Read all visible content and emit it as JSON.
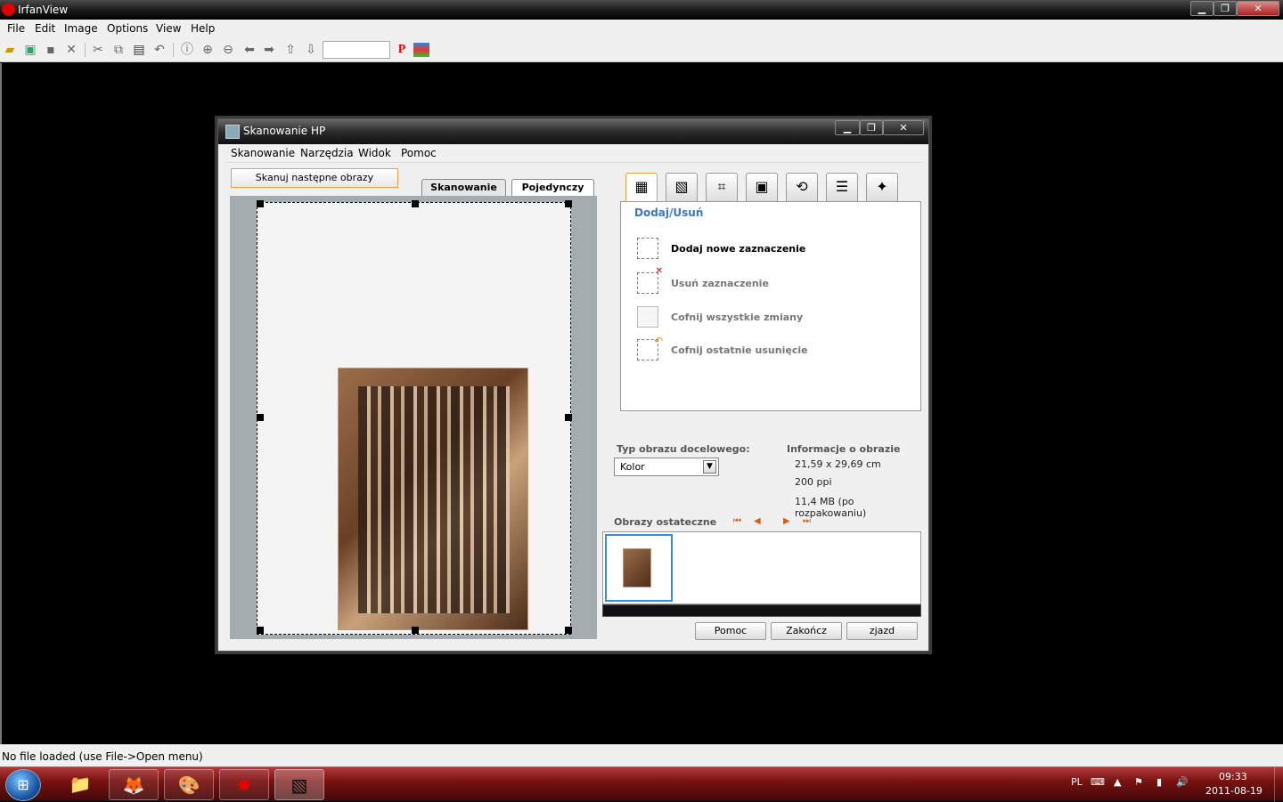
{
  "app": {
    "title": "IrfanView",
    "window_min": "▁",
    "window_max": "❐",
    "window_close": "✕"
  },
  "menu": [
    "File",
    "Edit",
    "Image",
    "Options",
    "View",
    "Help"
  ],
  "toolbar": {
    "icons": [
      "open-icon",
      "slideshow-icon",
      "save-icon",
      "delete-icon",
      "cut-icon",
      "copy-icon",
      "paste-icon",
      "undo-icon",
      "info-icon",
      "zoom-in-icon",
      "zoom-out-icon",
      "prev-icon",
      "next-icon",
      "upload-icon",
      "download-icon"
    ],
    "paint_label": "P"
  },
  "status": "No file loaded (use File->Open menu)",
  "dialog": {
    "title": "Skanowanie HP",
    "menu": [
      "Skanowanie",
      "Narzędzia",
      "Widok",
      "Pomoc"
    ],
    "scan_next": "Skanuj następne obrazy",
    "tabs": [
      "Skanowanie or...",
      "Pojedynczy ob..."
    ],
    "panel_title": "Dodaj/Usuń",
    "actions": [
      {
        "label": "Dodaj nowe zaznaczenie",
        "enabled": true
      },
      {
        "label": "Usuń zaznaczenie",
        "enabled": false
      },
      {
        "label": "Cofnij wszystkie zmiany",
        "enabled": false
      },
      {
        "label": "Cofnij ostatnie usunięcie",
        "enabled": false
      }
    ],
    "target_type_label": "Typ obrazu docelowego:",
    "target_type_value": "Kolor",
    "info_label": "Informacje o obrazie",
    "info_size": "21,59 x 29,69 cm",
    "info_ppi": "200 ppi",
    "info_mb": "11,4 MB (po rozpakowaniu)",
    "final_label": "Obrazy ostateczne",
    "buttons": {
      "help": "Pomoc",
      "finish": "Zakończ",
      "scan": "zjazd"
    }
  },
  "taskbar": {
    "lang": "PL",
    "time": "09:33",
    "date": "2011-08-19"
  }
}
